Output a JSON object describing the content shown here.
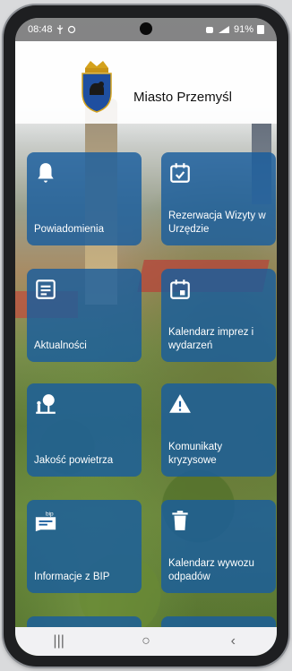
{
  "status_bar": {
    "time": "08:48",
    "left_icons": [
      "usb-icon",
      "notification-icon"
    ],
    "right_icons": [
      "alarm-icon",
      "signal-icon"
    ],
    "battery_percent": "91%"
  },
  "header": {
    "title": "Miasto Przemyśl",
    "logo": "city-crest-icon"
  },
  "tiles": [
    {
      "label": "Powiadomienia",
      "icon": "bell-icon"
    },
    {
      "label": "Rezerwacja Wizyty w Urzędzie",
      "icon": "calendar-check-icon"
    },
    {
      "label": "Aktualności",
      "icon": "news-icon"
    },
    {
      "label": "Kalendarz imprez i wydarzeń",
      "icon": "calendar-event-icon"
    },
    {
      "label": "Jakość powietrza",
      "icon": "tree-person-icon"
    },
    {
      "label": "Komunikaty kryzysowe",
      "icon": "warning-icon"
    },
    {
      "label": "Informacje z BIP",
      "icon": "bip-icon"
    },
    {
      "label": "Kalendarz wywozu odpadów",
      "icon": "trash-icon"
    }
  ],
  "nav_bar": {
    "recent": "|||",
    "home": "○",
    "back": "‹"
  },
  "colors": {
    "tile": "#185d9e",
    "header_bg": "#ffffff"
  }
}
